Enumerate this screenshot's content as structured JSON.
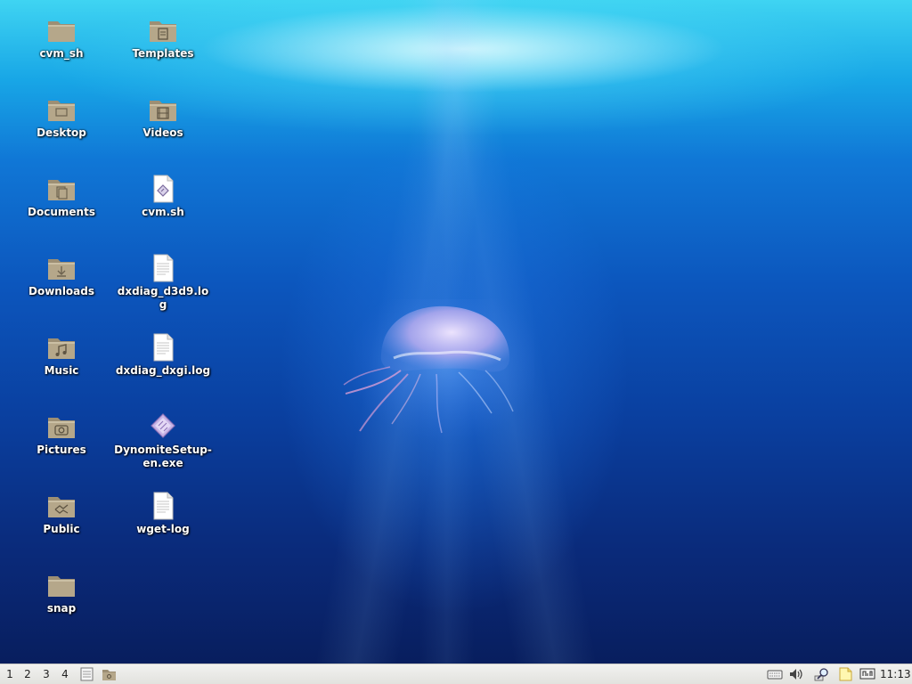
{
  "desktop": {
    "icons": [
      {
        "label": "cvm_sh",
        "icon": "folder-icon"
      },
      {
        "label": "Desktop",
        "icon": "desktop-folder-icon"
      },
      {
        "label": "Documents",
        "icon": "documents-folder-icon"
      },
      {
        "label": "Downloads",
        "icon": "downloads-folder-icon"
      },
      {
        "label": "Music",
        "icon": "music-folder-icon"
      },
      {
        "label": "Pictures",
        "icon": "pictures-folder-icon"
      },
      {
        "label": "Public",
        "icon": "public-folder-icon"
      },
      {
        "label": "snap",
        "icon": "folder-icon"
      },
      {
        "label": "Templates",
        "icon": "templates-folder-icon"
      },
      {
        "label": "Videos",
        "icon": "videos-folder-icon"
      },
      {
        "label": "cvm.sh",
        "icon": "shell-script-icon"
      },
      {
        "label": "dxdiag_d3d9.log",
        "icon": "text-file-icon"
      },
      {
        "label": "dxdiag_dxgi.log",
        "icon": "text-file-icon"
      },
      {
        "label": "DynomiteSetup-en.exe",
        "icon": "exe-installer-icon"
      },
      {
        "label": "wget-log",
        "icon": "text-file-icon"
      }
    ]
  },
  "taskbar": {
    "workspaces": [
      "1",
      "2",
      "3",
      "4"
    ],
    "launchers": [
      {
        "icon": "show-desktop-icon"
      },
      {
        "icon": "file-manager-icon"
      }
    ],
    "tray": [
      {
        "icon": "keyboard-icon"
      },
      {
        "icon": "volume-icon"
      },
      {
        "icon": "search-tool-icon"
      },
      {
        "icon": "notes-icon"
      },
      {
        "icon": "network-icon"
      }
    ],
    "clock": "11:13"
  },
  "colors": {
    "folder": "#b5a78a",
    "taskbar": "#eaeae6",
    "label_text": "#ffffff"
  }
}
